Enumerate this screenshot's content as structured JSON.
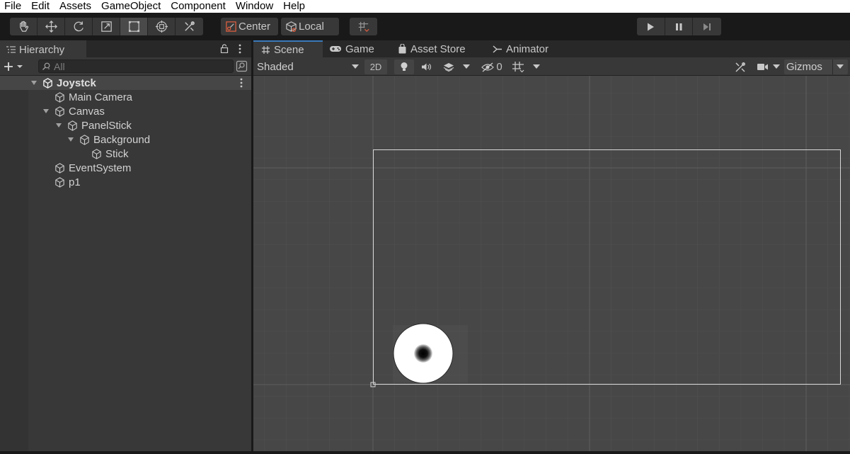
{
  "menu": [
    "File",
    "Edit",
    "Assets",
    "GameObject",
    "Component",
    "Window",
    "Help"
  ],
  "toolbar": {
    "tools": [
      "hand-tool",
      "move-tool",
      "rotate-tool",
      "scale-tool",
      "rect-tool",
      "transform-tool",
      "custom-editor-tool"
    ],
    "active_tool": "rect-tool",
    "pivot_label": "Center",
    "space_label": "Local"
  },
  "hierarchy": {
    "tab_label": "Hierarchy",
    "search_placeholder": "All",
    "scene_name": "Joystck",
    "items": [
      {
        "label": "Main Camera",
        "depth": 1,
        "expanded": null
      },
      {
        "label": "Canvas",
        "depth": 1,
        "expanded": true
      },
      {
        "label": "PanelStick",
        "depth": 2,
        "expanded": true
      },
      {
        "label": "Background",
        "depth": 3,
        "expanded": true
      },
      {
        "label": "Stick",
        "depth": 4,
        "expanded": null
      },
      {
        "label": "EventSystem",
        "depth": 1,
        "expanded": null
      },
      {
        "label": "p1",
        "depth": 1,
        "expanded": null
      }
    ]
  },
  "scene_view": {
    "tabs": [
      "Scene",
      "Game",
      "Asset Store",
      "Animator"
    ],
    "active_tab": "Scene",
    "shading_mode": "Shaded",
    "mode_2d_label": "2D",
    "hidden_count": "0",
    "gizmos_label": "Gizmos"
  },
  "colors": {
    "accent": "#3a79bb",
    "panel": "#383838",
    "viewport": "#474747"
  }
}
